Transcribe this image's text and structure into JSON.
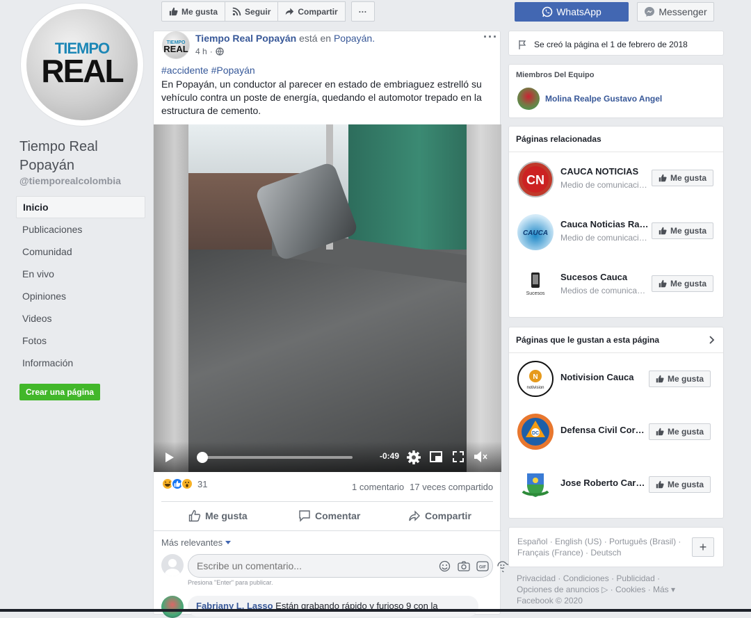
{
  "page": {
    "logo_line1": "TIEMPO",
    "logo_line2": "REAL",
    "name": "Tiempo Real Popayán",
    "handle": "@tiemporealcolombia",
    "create_page": "Crear una página"
  },
  "nav": [
    {
      "label": "Inicio",
      "active": true
    },
    {
      "label": "Publicaciones"
    },
    {
      "label": "Comunidad"
    },
    {
      "label": "En vivo"
    },
    {
      "label": "Opiniones"
    },
    {
      "label": "Videos"
    },
    {
      "label": "Fotos"
    },
    {
      "label": "Información"
    }
  ],
  "actions": {
    "like": "Me gusta",
    "follow": "Seguir",
    "share": "Compartir",
    "more": "···",
    "whatsapp": "WhatsApp",
    "messenger": "Messenger"
  },
  "post": {
    "author": "Tiempo Real Popayán",
    "location_prefix": "está en",
    "location": "Popayán.",
    "time": "4 h",
    "more": "···",
    "hashtags": "#accidente #Popayán",
    "text": "En Popayán, un conductor al parecer en estado de embriaguez estrelló su vehículo contra un poste de energía, quedando el automotor trepado en la estructura de cemento.",
    "video_time": "-0:49",
    "video_progress": 0.02,
    "reaction_count": "31",
    "comments": "1 comentario",
    "shares": "17 veces compartido",
    "btn_like": "Me gusta",
    "btn_comment": "Comentar",
    "btn_share": "Compartir",
    "sort": "Más relevantes",
    "comment_placeholder": "Escribe un comentario...",
    "comment_hint": "Presiona \"Enter\" para publicar.",
    "comment1_name": "Fabriany L. Lasso",
    "comment1_text": "Están grabando rápido y furioso 9 con la"
  },
  "sidebar": {
    "created": "Se creó la página el 1 de febrero de 2018",
    "team_title": "Miembros Del Equipo",
    "team_member": "Molina Realpe Gustavo Angel",
    "related_title": "Páginas relacionadas",
    "related": [
      {
        "name": "CAUCA NOTICIAS",
        "category": "Medio de comunicación/noticias",
        "like": "Me gusta"
      },
      {
        "name": "Cauca Noticias Radio",
        "category": "Medio de comunicación/noticias",
        "like": "Me gusta"
      },
      {
        "name": "Sucesos Cauca",
        "category": "Medios de comunicación/noticias",
        "like": "Me gusta"
      }
    ],
    "liked_title": "Páginas que le gustan a esta página",
    "liked": [
      {
        "name": "Notivision Cauca",
        "like": "Me gusta"
      },
      {
        "name": "Defensa Civil Corporación",
        "like": "Me gusta"
      },
      {
        "name": "Jose Roberto Cardona",
        "like": "Me gusta"
      }
    ],
    "languages": "Español · English (US) · Português (Brasil) · Français (France) · Deutsch",
    "footer_line1": "Privacidad · Condiciones · Publicidad ·",
    "footer_line2": "Opciones de anuncios ▷ · Cookies · Más ▾",
    "footer_line3": "Facebook © 2020"
  },
  "colors": {
    "fb_blue": "#4267b2",
    "link": "#385898",
    "green": "#42b72a",
    "background": "#e9ebee"
  }
}
